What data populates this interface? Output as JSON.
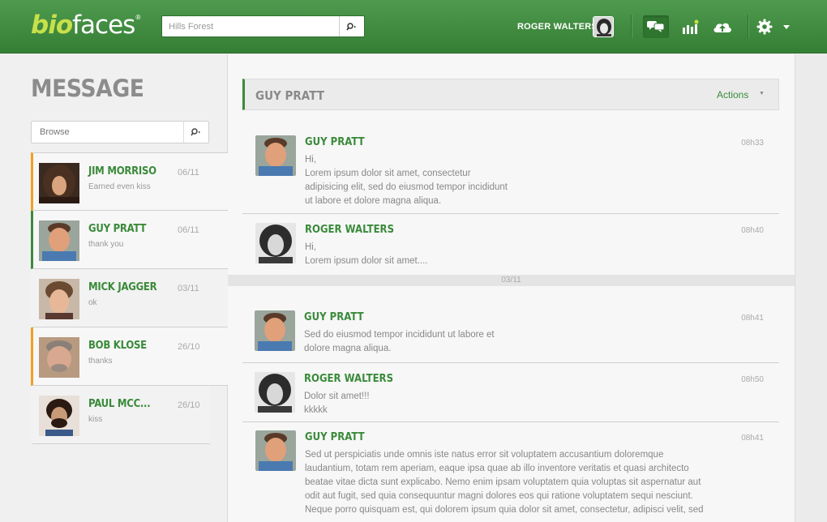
{
  "header": {
    "logo_bio": "bio",
    "logo_faces": "faces",
    "logo_mark": "®",
    "search_value": "Hills Forest",
    "user_name": "ROGER WALTERS",
    "icons": [
      "messages-icon",
      "stats-icon",
      "upload-cloud-icon",
      "gear-icon",
      "chevron-down-icon"
    ]
  },
  "sidebar": {
    "title": "MESSAGE",
    "browse_placeholder": "Browse",
    "conversations": [
      {
        "name": "JIM MORRISO",
        "date": "06/11",
        "preview": "Earned even kiss",
        "state": "unread"
      },
      {
        "name": "GUY PRATT",
        "date": "06/11",
        "preview": "thank you",
        "state": "active"
      },
      {
        "name": "MICK JAGGER",
        "date": "03/11",
        "preview": "ok",
        "state": "read"
      },
      {
        "name": "BOB KLOSE",
        "date": "26/10",
        "preview": "thanks",
        "state": "unread"
      },
      {
        "name": "PAUL MCC...",
        "date": "26/10",
        "preview": "kiss",
        "state": "read"
      }
    ]
  },
  "conversation": {
    "title": "GUY PRATT",
    "actions_label": "Actions",
    "day_separator": "03/11",
    "messages": [
      {
        "author": "GUY PRATT",
        "time": "08h33",
        "lines": [
          "Hi,",
          "Lorem ipsum dolor sit amet, consectetur",
          "adipisicing elit, sed do eiusmod tempor incididunt",
          "ut labore et dolore magna aliqua."
        ]
      },
      {
        "author": "ROGER WALTERS",
        "time": "08h40",
        "lines": [
          "Hi,",
          "Lorem ipsum dolor sit amet...."
        ]
      },
      {
        "author": "GUY PRATT",
        "time": "08h41",
        "lines": [
          "Sed do eiusmod tempor incididunt ut labore et",
          "dolore magna aliqua."
        ]
      },
      {
        "author": "ROGER WALTERS",
        "time": "08h50",
        "lines": [
          "Dolor sit amet!!!",
          "kkkkk"
        ]
      },
      {
        "author": "GUY PRATT",
        "time": "08h41",
        "lines": [
          "Sed ut perspiciatis unde omnis iste natus error sit voluptatem accusantium doloremque",
          "laudantium, totam rem aperiam, eaque ipsa quae ab illo inventore veritatis et quasi architecto",
          "beatae vitae dicta sunt explicabo. Nemo enim ipsam voluptatem quia voluptas sit aspernatur aut",
          "odit aut fugit, sed quia consequuntur magni dolores eos qui ratione voluptatem sequi nesciunt.",
          "Neque porro quisquam est, qui dolorem ipsum quia dolor sit amet, consectetur, adipisci velit, sed"
        ]
      }
    ]
  },
  "colors": {
    "brand_green": "#3d8a3d",
    "accent_lime": "#c8e04a",
    "unread_orange": "#f0a020"
  }
}
